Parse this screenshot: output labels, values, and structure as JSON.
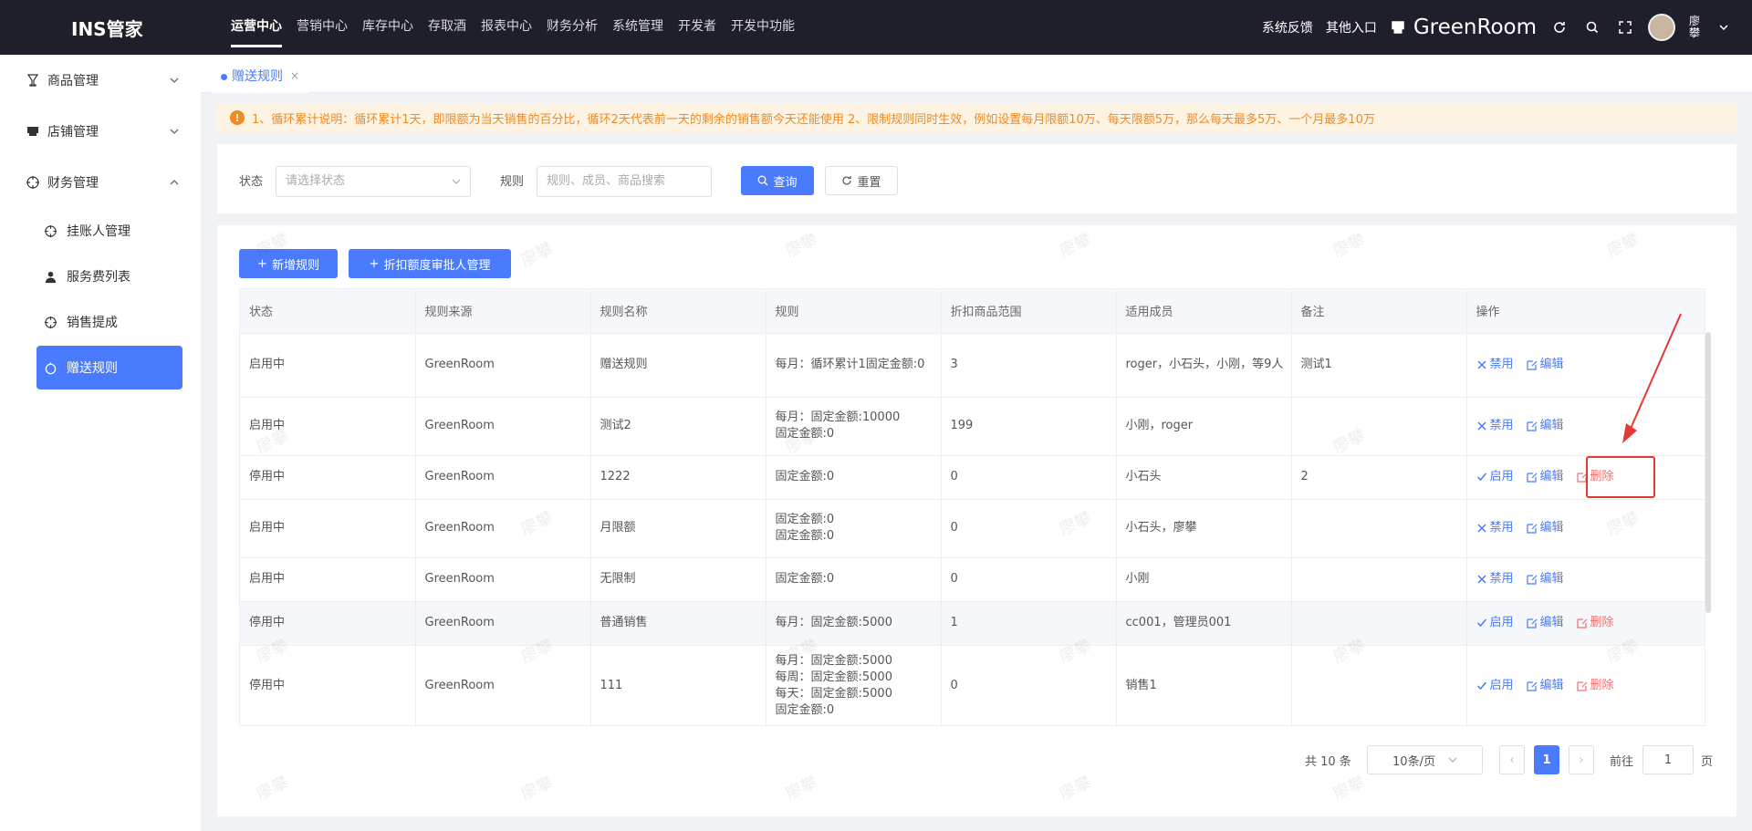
{
  "app": {
    "title": "INS管家"
  },
  "topnav": [
    "运营中心",
    "营销中心",
    "库存中心",
    "存取酒",
    "报表中心",
    "财务分析",
    "系统管理",
    "开发者",
    "开发中功能"
  ],
  "topright": {
    "feedback": "系统反馈",
    "other": "其他入口",
    "store": "GreenRoom",
    "user_name": "廖攀"
  },
  "sidebar": {
    "goods": "商品管理",
    "store": "店铺管理",
    "finance": "财务管理",
    "subs": [
      "挂账人管理",
      "服务费列表",
      "销售提成",
      "赠送规则"
    ]
  },
  "tab": {
    "label": "赠送规则",
    "close": "×"
  },
  "notice": "1、循环累计说明：循环累计1天，即限额为当天销售的百分比，循环2天代表前一天的剩余的销售额今天还能使用 2、限制规则同时生效，例如设置每月限额10万、每天限额5万，那么每天最多5万、一个月最多10万",
  "filter": {
    "status_label": "状态",
    "status_placeholder": "请选择状态",
    "rule_label": "规则",
    "rule_placeholder": "规则、成员、商品搜索",
    "query": "查询",
    "reset": "重置"
  },
  "actions": {
    "add_rule": "新增规则",
    "approver": "折扣额度审批人管理"
  },
  "columns": [
    "状态",
    "规则来源",
    "规则名称",
    "规则",
    "折扣商品范围",
    "适用成员",
    "备注",
    "操作"
  ],
  "ops": {
    "disable": "禁用",
    "enable": "启用",
    "edit": "编辑",
    "delete": "删除"
  },
  "rows": [
    {
      "status": "启用中",
      "source": "GreenRoom",
      "name": "赠送规则",
      "rule": "每月：循环累计1固定金额:0",
      "scope": "3",
      "members": "roger，小石头，小刚，等9人",
      "note": "测试1",
      "state": "on",
      "del": false
    },
    {
      "status": "启用中",
      "source": "GreenRoom",
      "name": "测试2",
      "rule": "每月：固定金额:10000\n固定金额:0",
      "scope": "199",
      "members": "小刚，roger",
      "note": "",
      "state": "on",
      "del": false
    },
    {
      "status": "停用中",
      "source": "GreenRoom",
      "name": "1222",
      "rule": "固定金额:0",
      "scope": "0",
      "members": "小石头",
      "note": "2",
      "state": "off",
      "del": true
    },
    {
      "status": "启用中",
      "source": "GreenRoom",
      "name": "月限额",
      "rule": "固定金额:0\n固定金额:0",
      "scope": "0",
      "members": "小石头，廖攀",
      "note": "",
      "state": "on",
      "del": false
    },
    {
      "status": "启用中",
      "source": "GreenRoom",
      "name": "无限制",
      "rule": "固定金额:0",
      "scope": "0",
      "members": "小刚",
      "note": "",
      "state": "on",
      "del": false
    },
    {
      "status": "停用中",
      "source": "GreenRoom",
      "name": "普通销售",
      "rule": "每月：固定金额:5000",
      "scope": "1",
      "members": "cc001，管理员001",
      "note": "",
      "state": "off",
      "del": true
    },
    {
      "status": "停用中",
      "source": "GreenRoom",
      "name": "111",
      "rule": "每月：固定金额:5000\n每周：固定金额:5000\n每天：固定金额:5000\n固定金额:0",
      "scope": "0",
      "members": "销售1",
      "note": "",
      "state": "off",
      "del": true
    }
  ],
  "pagination": {
    "total": "共 10 条",
    "page_size": "10条/页",
    "current": "1",
    "goto_label": "前往",
    "goto_value": "1",
    "page_unit": "页",
    "prev": "‹",
    "next": "›"
  },
  "watermark": "廖攀",
  "colors": {
    "primary": "#4a7bff",
    "danger": "#f56c6c",
    "warning": "#f08a24",
    "topbar": "#1f1f2c"
  }
}
